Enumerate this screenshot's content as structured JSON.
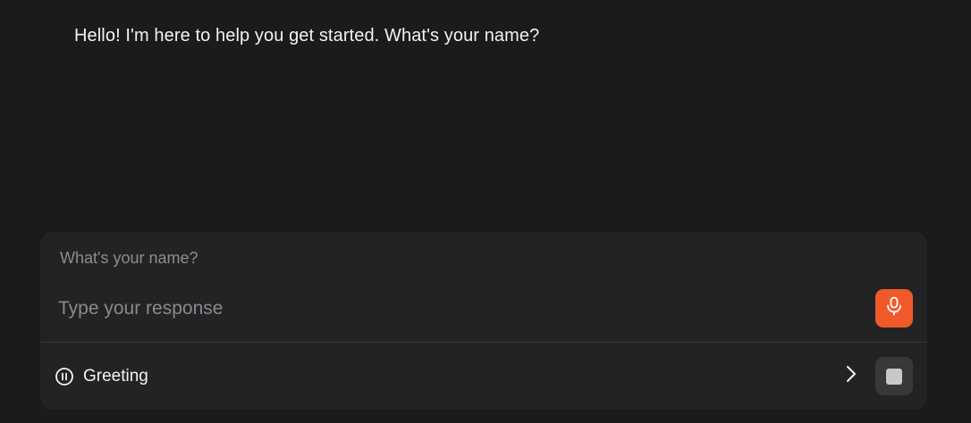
{
  "conversation": {
    "assistant_message": "Hello! I'm here to help you get started. What's your name?"
  },
  "input_panel": {
    "prompt_label": "What's your name?",
    "response_placeholder": "Type your response",
    "response_value": "",
    "mic_icon": "microphone-icon"
  },
  "status_bar": {
    "step_label": "Greeting",
    "status_icon": "pause-circle-icon",
    "next_icon": "chevron-right-icon",
    "stop_icon": "stop-square-icon"
  },
  "colors": {
    "background": "#1b1b1d",
    "panel": "#232325",
    "accent": "#f05a2a",
    "stop_button": "#38383b"
  }
}
